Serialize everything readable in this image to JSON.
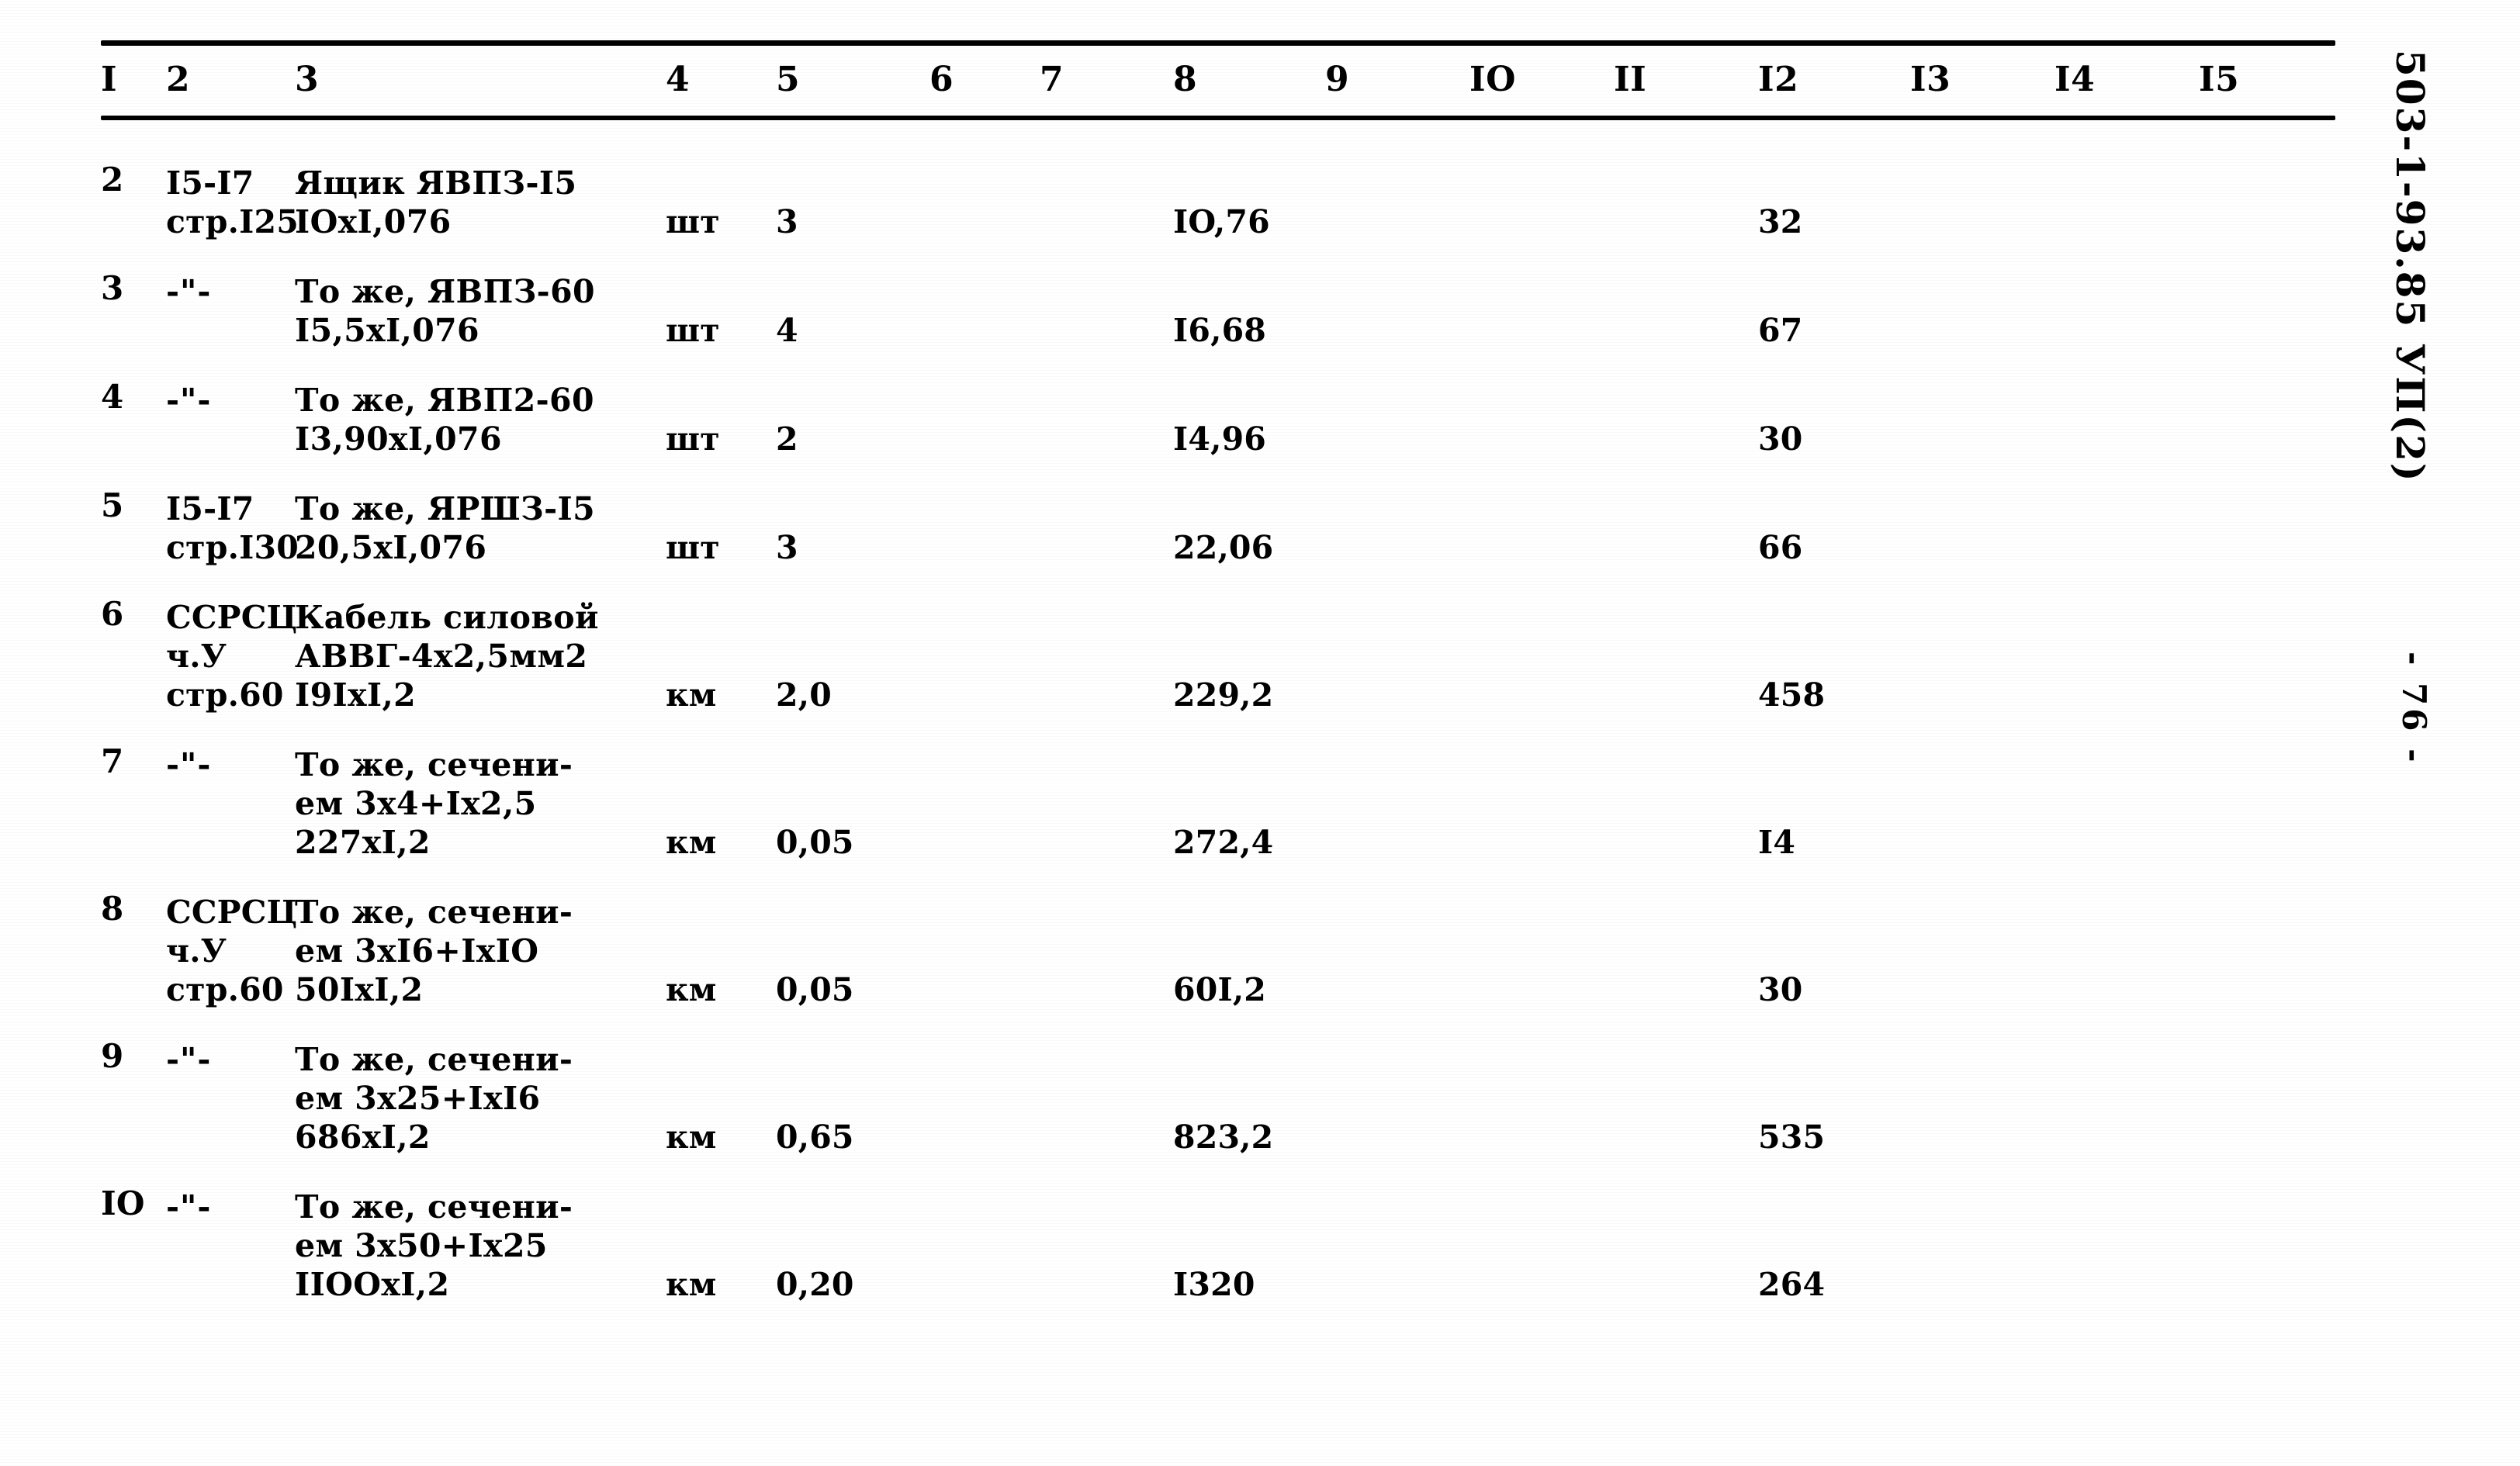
{
  "document": {
    "code_margin": "503-1-93.85 УП(2)",
    "page_number": "- 76 -"
  },
  "table": {
    "column_numbers": [
      "I",
      "2",
      "3",
      "4",
      "5",
      "6",
      "7",
      "8",
      "9",
      "IO",
      "II",
      "I2",
      "I3",
      "I4",
      "I5"
    ],
    "rows": [
      {
        "pos": "2",
        "source": "I5-I7\nстр.I25",
        "description": "Ящик ЯВПЗ-I5\nIOxI,076",
        "unit": "шт",
        "qty": "3",
        "c6": "",
        "c7": "",
        "c8": "IO,76",
        "c9": "",
        "c10": "",
        "c11": "",
        "c12": "32",
        "c13": "",
        "c14": "",
        "c15": ""
      },
      {
        "pos": "3",
        "source": "-\"-",
        "description": "То же, ЯВПЗ-60\nI5,5xI,076",
        "unit": "шт",
        "qty": "4",
        "c6": "",
        "c7": "",
        "c8": "I6,68",
        "c9": "",
        "c10": "",
        "c11": "",
        "c12": "67",
        "c13": "",
        "c14": "",
        "c15": ""
      },
      {
        "pos": "4",
        "source": "-\"-",
        "description": "То же, ЯВП2-60\nI3,90xI,076",
        "unit": "шт",
        "qty": "2",
        "c6": "",
        "c7": "",
        "c8": "I4,96",
        "c9": "",
        "c10": "",
        "c11": "",
        "c12": "30",
        "c13": "",
        "c14": "",
        "c15": ""
      },
      {
        "pos": "5",
        "source": "I5-I7\nстр.I30",
        "description": "То же, ЯРШЗ-I5\n20,5xI,076",
        "unit": "шт",
        "qty": "3",
        "c6": "",
        "c7": "",
        "c8": "22,06",
        "c9": "",
        "c10": "",
        "c11": "",
        "c12": "66",
        "c13": "",
        "c14": "",
        "c15": ""
      },
      {
        "pos": "6",
        "source": "ССРСЦ\nч.У\nстр.60",
        "description": "Кабель силовой\nАВВГ-4х2,5мм2\nI9IxI,2",
        "unit": "км",
        "qty": "2,0",
        "c6": "",
        "c7": "",
        "c8": "229,2",
        "c9": "",
        "c10": "",
        "c11": "",
        "c12": "458",
        "c13": "",
        "c14": "",
        "c15": ""
      },
      {
        "pos": "7",
        "source": "-\"-",
        "description": "То же, сечени-\nем 3х4+Iх2,5\n227хI,2",
        "unit": "км",
        "qty": "0,05",
        "c6": "",
        "c7": "",
        "c8": "272,4",
        "c9": "",
        "c10": "",
        "c11": "",
        "c12": "I4",
        "c13": "",
        "c14": "",
        "c15": ""
      },
      {
        "pos": "8",
        "source": "ССРСЦ\nч.У\nстр.60",
        "description": "То же, сечени-\nем 3хI6+IхIO\n50IxI,2",
        "unit": "км",
        "qty": "0,05",
        "c6": "",
        "c7": "",
        "c8": "60I,2",
        "c9": "",
        "c10": "",
        "c11": "",
        "c12": "30",
        "c13": "",
        "c14": "",
        "c15": ""
      },
      {
        "pos": "9",
        "source": "-\"-",
        "description": "То же, сечени-\nем 3х25+IхI6\n686хI,2",
        "unit": "км",
        "qty": "0,65",
        "c6": "",
        "c7": "",
        "c8": "823,2",
        "c9": "",
        "c10": "",
        "c11": "",
        "c12": "535",
        "c13": "",
        "c14": "",
        "c15": ""
      },
      {
        "pos": "IO",
        "source": "-\"-",
        "description": "То же, сечени-\nем 3х50+Iх25\nIIOOxI,2",
        "unit": "км",
        "qty": "0,20",
        "c6": "",
        "c7": "",
        "c8": "I320",
        "c9": "",
        "c10": "",
        "c11": "",
        "c12": "264",
        "c13": "",
        "c14": "",
        "c15": ""
      }
    ]
  },
  "colors": {
    "ink": "#000000",
    "paper": "#ffffff"
  }
}
